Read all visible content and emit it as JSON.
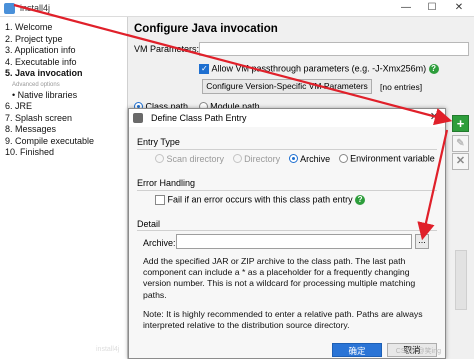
{
  "window": {
    "title": "install4j",
    "minimize_glyph": "—",
    "maximize_glyph": "☐",
    "close_glyph": "✕"
  },
  "sidebar": {
    "steps": [
      {
        "label": "1. Welcome"
      },
      {
        "label": "2. Project type"
      },
      {
        "label": "3. Application info"
      },
      {
        "label": "4. Executable info"
      },
      {
        "label": "5. Java invocation"
      },
      {
        "label": "Advanced options"
      },
      {
        "label": "• Native libraries"
      },
      {
        "label": "6. JRE"
      },
      {
        "label": "7. Splash screen"
      },
      {
        "label": "8. Messages"
      },
      {
        "label": "9. Compile executable"
      },
      {
        "label": "10. Finished"
      }
    ],
    "current_step": "5. Java invocation",
    "logo_text": "install4j"
  },
  "main": {
    "title": "Configure Java invocation",
    "vm_parameters_label": "VM Parameters:",
    "vm_parameters_value": "",
    "allow_passthrough_label": "Allow VM passthrough parameters (e.g. -J-Xmx256m)",
    "allow_passthrough_checked": true,
    "configure_button_label": "Configure Version-Specific VM Parameters",
    "entries_status": "[no entries]",
    "class_path_label": "Class path",
    "module_path_label": "Module path",
    "selected_path_mode": "Class path"
  },
  "toolbar": {
    "add_glyph": "+",
    "edit_glyph": "✎",
    "delete_glyph": "✕"
  },
  "dialog": {
    "title": "Define Class Path Entry",
    "close_glyph": "✕",
    "entry_type_heading": "Entry Type",
    "entry_types": [
      {
        "label": "Scan directory",
        "enabled": false
      },
      {
        "label": "Directory",
        "enabled": false
      },
      {
        "label": "Archive",
        "enabled": true
      },
      {
        "label": "Environment variable",
        "enabled": true
      }
    ],
    "selected_entry_type": "Archive",
    "error_handling_heading": "Error Handling",
    "fail_label": "Fail if an error occurs with this class path entry",
    "fail_checked": false,
    "detail_heading": "Detail",
    "archive_label": "Archive:",
    "archive_value": "",
    "browse_glyph": "...",
    "description_1": "Add the specified JAR or ZIP archive to the class path. The last path component can include a * as a placeholder for a frequently changing version number. This is not a wildcard for processing multiple matching paths.",
    "description_2": "Note: It is highly recommended to enter a relative path. Paths are always interpreted relative to the distribution source directory.",
    "ok_label": "确定",
    "cancel_label": "取消",
    "watermark": "CSDN @笑ing"
  },
  "colors": {
    "accent": "#1e6fd0",
    "help_green": "#2e9e3c",
    "annotation_red": "#e0202a"
  },
  "icons": [
    "app-icon",
    "help-icon",
    "add-icon",
    "edit-icon",
    "delete-icon",
    "dialog-icon",
    "close-icon",
    "browse-icon"
  ]
}
